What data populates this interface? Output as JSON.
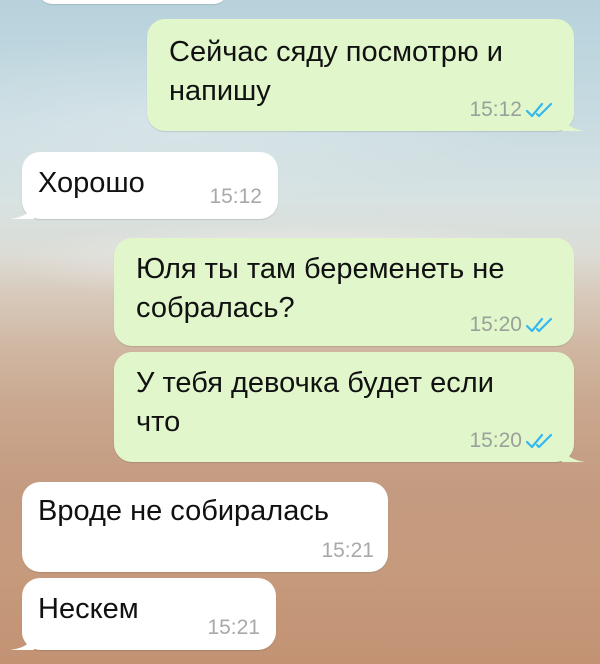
{
  "colors": {
    "outgoing_bubble": "#e1f7cb",
    "incoming_bubble": "#ffffff",
    "read_ticks": "#34b7f1",
    "timestamp": "#9aa09a"
  },
  "messages": [
    {
      "direction": "outgoing",
      "text": "Сейчас сяду посмотрю и\nнапишу",
      "time": "15:12",
      "status_icon": "double-check-read"
    },
    {
      "direction": "incoming",
      "text": "Хорошо",
      "time": "15:12"
    },
    {
      "direction": "outgoing",
      "text": "Юля ты там беременеть не\nсобралась?",
      "time": "15:20",
      "status_icon": "double-check-read"
    },
    {
      "direction": "outgoing",
      "text": "У тебя девочка будет если\nчто",
      "time": "15:20",
      "status_icon": "double-check-read"
    },
    {
      "direction": "incoming",
      "text": "Вроде не собиралась",
      "time": "15:21"
    },
    {
      "direction": "incoming",
      "text": "Нескем",
      "time": "15:21"
    }
  ]
}
